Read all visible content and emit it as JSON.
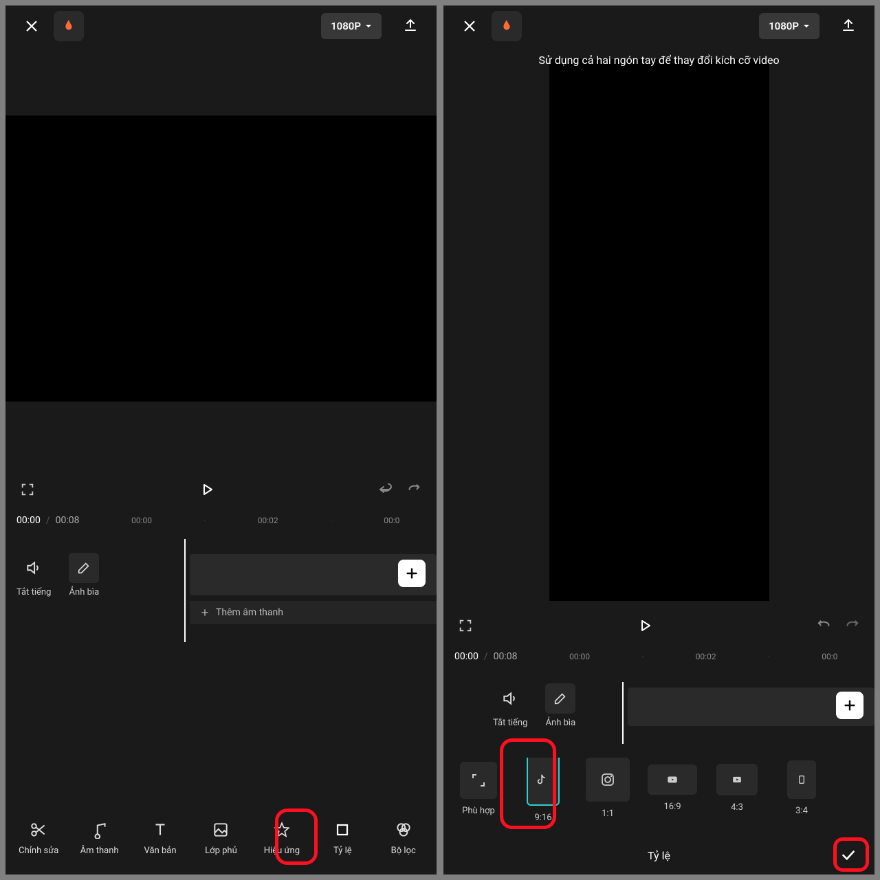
{
  "top": {
    "resolution": "1080P"
  },
  "hint": "Sử dụng cả hai ngón tay để thay đổi kích cỡ video",
  "time": {
    "current": "00:00",
    "total": "00:08"
  },
  "ticks": [
    "00:00",
    "·",
    "00:02",
    "·",
    "00:0"
  ],
  "ticks2": [
    "00:00",
    "·",
    "00:02",
    "·",
    "00:0"
  ],
  "timeline": {
    "mute": "Tắt tiếng",
    "cover": "Ảnh bìa",
    "add_audio": "Thêm âm thanh"
  },
  "tools": [
    {
      "id": "edit",
      "label": "Chỉnh sửa"
    },
    {
      "id": "audio",
      "label": "Âm thanh"
    },
    {
      "id": "text",
      "label": "Văn bản"
    },
    {
      "id": "overlay",
      "label": "Lớp phủ"
    },
    {
      "id": "effect",
      "label": "Hiệu ứng"
    },
    {
      "id": "ratio",
      "label": "Tỷ lệ"
    },
    {
      "id": "filter",
      "label": "Bộ lọc"
    }
  ],
  "ratio": {
    "items": [
      {
        "id": "fit",
        "label": "Phù hợp"
      },
      {
        "id": "9_16",
        "label": "9:16"
      },
      {
        "id": "1_1",
        "label": "1:1"
      },
      {
        "id": "16_9",
        "label": "16:9"
      },
      {
        "id": "4_3",
        "label": "4:3"
      },
      {
        "id": "3_4",
        "label": "3:4"
      }
    ],
    "title": "Tỷ lệ"
  }
}
